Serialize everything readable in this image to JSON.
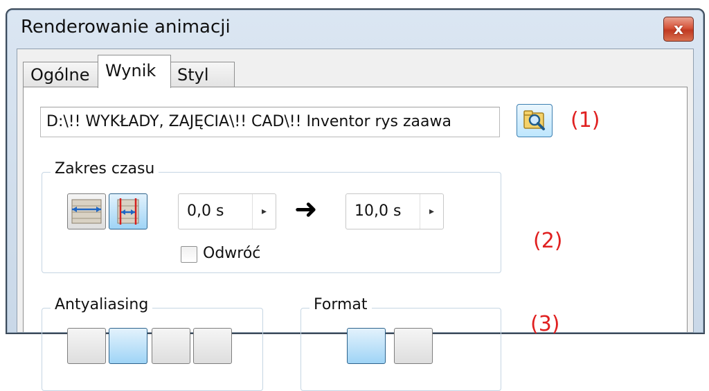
{
  "window": {
    "title": "Renderowanie animacji",
    "close_label": "x"
  },
  "tabs": [
    {
      "label": "Ogólne",
      "active": false
    },
    {
      "label": "Wynik",
      "active": true
    },
    {
      "label": "Styl",
      "active": false
    }
  ],
  "output": {
    "path_value": "D:\\!! WYKŁADY, ZAJĘCIA\\!! CAD\\!! Inventor rys zaawa",
    "annotation": "(1)"
  },
  "time_range": {
    "label": "Zakres czasu",
    "start_value": "0,0 s",
    "end_value": "10,0 s",
    "reverse_label": "Odwróć",
    "reverse_checked": false,
    "annotation": "(2)"
  },
  "antialiasing": {
    "label": "Antyaliasing"
  },
  "format": {
    "label": "Format",
    "annotation": "(3)"
  },
  "icons": {
    "close": "close-icon",
    "browse": "folder-search-icon",
    "full_range": "full-range-icon",
    "custom_range": "custom-range-icon",
    "arrow": "arrow-right-icon",
    "spin": "spin-arrow-icon"
  },
  "colors": {
    "annotation": "#e02020",
    "accent": "#3c7fb1"
  }
}
